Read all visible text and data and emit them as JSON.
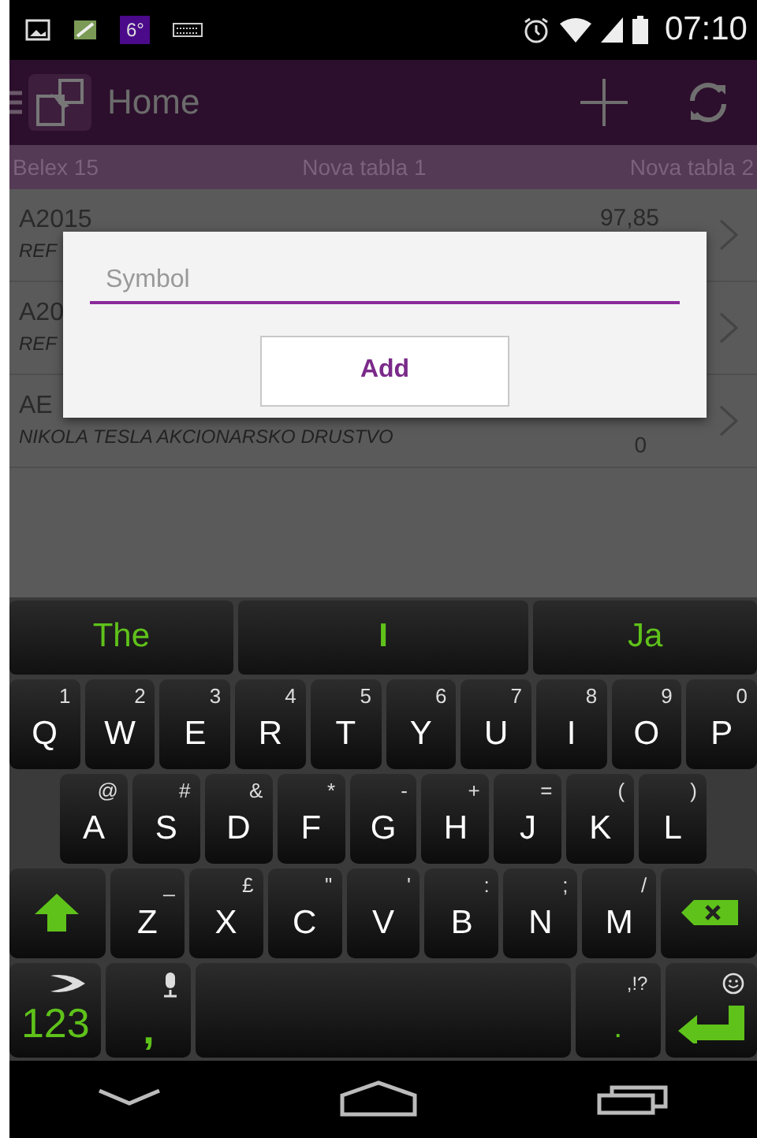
{
  "status_bar": {
    "badge": "6°",
    "time": "07:10"
  },
  "action_bar": {
    "title": "Home"
  },
  "tabs": [
    {
      "label": "Belex 15",
      "selected": false
    },
    {
      "label": "Nova tabla 1",
      "selected": false
    },
    {
      "label": "Nova tabla 2",
      "selected": false
    }
  ],
  "rows": [
    {
      "symbol": "A2015",
      "name": "REF",
      "value": "97,85"
    },
    {
      "symbol": "A20",
      "name": "REF"
    },
    {
      "symbol": "AE",
      "name": "NIKOLA TESLA AKCIONARSKO DRUSTVO",
      "change": "0"
    }
  ],
  "dialog": {
    "placeholder": "Symbol",
    "button": "Add"
  },
  "keyboard": {
    "suggestions": [
      "The",
      "I",
      "Ja"
    ],
    "rows": [
      [
        {
          "kind": "letter",
          "label": "Q",
          "hint": "1"
        },
        {
          "kind": "letter",
          "label": "W",
          "hint": "2"
        },
        {
          "kind": "letter",
          "label": "E",
          "hint": "3"
        },
        {
          "kind": "letter",
          "label": "R",
          "hint": "4"
        },
        {
          "kind": "letter",
          "label": "T",
          "hint": "5"
        },
        {
          "kind": "letter",
          "label": "Y",
          "hint": "6"
        },
        {
          "kind": "letter",
          "label": "U",
          "hint": "7"
        },
        {
          "kind": "letter",
          "label": "I",
          "hint": "8"
        },
        {
          "kind": "letter",
          "label": "O",
          "hint": "9"
        },
        {
          "kind": "letter",
          "label": "P",
          "hint": "0"
        }
      ],
      [
        {
          "kind": "letter",
          "label": "A",
          "hint": "@"
        },
        {
          "kind": "letter",
          "label": "S",
          "hint": "#"
        },
        {
          "kind": "letter",
          "label": "D",
          "hint": "&"
        },
        {
          "kind": "letter",
          "label": "F",
          "hint": "*"
        },
        {
          "kind": "letter",
          "label": "G",
          "hint": "-"
        },
        {
          "kind": "letter",
          "label": "H",
          "hint": "+"
        },
        {
          "kind": "letter",
          "label": "J",
          "hint": "="
        },
        {
          "kind": "letter",
          "label": "K",
          "hint": "("
        },
        {
          "kind": "letter",
          "label": "L",
          "hint": ")"
        }
      ],
      [
        {
          "kind": "shift"
        },
        {
          "kind": "letter",
          "label": "Z",
          "hint": "_"
        },
        {
          "kind": "letter",
          "label": "X",
          "hint": "£"
        },
        {
          "kind": "letter",
          "label": "C",
          "hint": "\""
        },
        {
          "kind": "letter",
          "label": "V",
          "hint": "'"
        },
        {
          "kind": "letter",
          "label": "B",
          "hint": ":"
        },
        {
          "kind": "letter",
          "label": "N",
          "hint": ";"
        },
        {
          "kind": "letter",
          "label": "M",
          "hint": "/"
        },
        {
          "kind": "backspace"
        }
      ],
      [
        {
          "kind": "symbols",
          "label": "123"
        },
        {
          "kind": "comma",
          "label": ","
        },
        {
          "kind": "space"
        },
        {
          "kind": "period",
          "label": ".",
          "hint": ",!?"
        },
        {
          "kind": "enter"
        }
      ]
    ]
  }
}
